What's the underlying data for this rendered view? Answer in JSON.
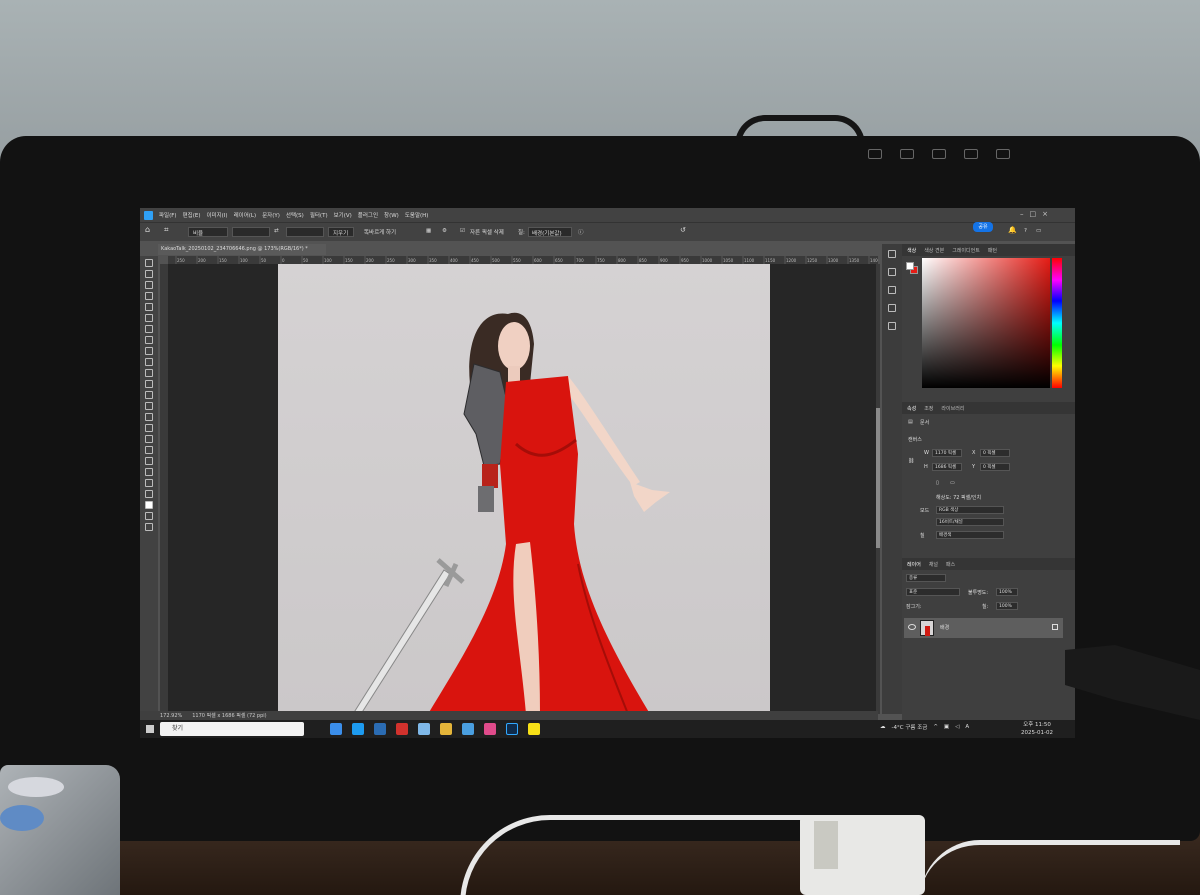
{
  "menu": {
    "items": [
      "파일(F)",
      "편집(E)",
      "이미지(I)",
      "레이어(L)",
      "문자(Y)",
      "선택(S)",
      "필터(T)",
      "보기(V)",
      "플러그인",
      "창(W)",
      "도움말(H)"
    ]
  },
  "share_label": "공유",
  "options": {
    "ratio": "비율",
    "clear": "지우기",
    "straighten": "똑바르게 하기",
    "delete_pixels": "자른 픽셀 삭제",
    "fill_label": "칠:",
    "fill_value": "배경(기본값)"
  },
  "document_tab": "KakaoTalk_20250102_234706646.png @ 173%(RGB/16*) *",
  "ruler_ticks": [
    "250",
    "200",
    "150",
    "100",
    "50",
    "0",
    "50",
    "100",
    "150",
    "200",
    "250",
    "300",
    "350",
    "400",
    "450",
    "500",
    "550",
    "600",
    "650",
    "700",
    "750",
    "800",
    "850",
    "900",
    "950",
    "1000",
    "1050",
    "1100",
    "1150",
    "1200",
    "1250",
    "1300",
    "1350",
    "1400"
  ],
  "status": {
    "zoom": "172.92%",
    "doc_size": "1170 픽셀 x 1686 픽셀 (72 ppi)"
  },
  "color_panel": {
    "tabs": [
      "색상",
      "색상 견본",
      "그레이디언트",
      "패턴"
    ],
    "fg_color": "#ffffff",
    "bg_color": "#e51c15"
  },
  "properties_panel": {
    "tabs": [
      "속성",
      "조정",
      "라이브러리"
    ],
    "doc_label": "문서",
    "section": "캔버스",
    "w_label": "W",
    "w_value": "1170 픽셀",
    "h_label": "H",
    "h_value": "1686 픽셀",
    "x_label": "X",
    "x_value": "0 픽셀",
    "y_label": "Y",
    "y_value": "0 픽셀",
    "resolution": "해상도: 72 픽셀/인치",
    "mode_label": "모드",
    "mode_value": "RGB 색상",
    "depth_value": "16비트/채널",
    "fill_label": "칠",
    "fill_value": "배경색"
  },
  "layers_panel": {
    "tabs": [
      "레이어",
      "채널",
      "패스"
    ],
    "kind": "종류",
    "blend": "표준",
    "opacity_label": "불투명도:",
    "opacity_value": "100%",
    "lock_label": "잠그기:",
    "fill_label": "칠:",
    "fill_value": "100%",
    "layer_name": "배경"
  },
  "taskbar": {
    "search_placeholder": "찾기",
    "weather": "-4°C 구름 조금",
    "time": "오후 11:50",
    "date": "2025-01-02",
    "ime": "A"
  }
}
